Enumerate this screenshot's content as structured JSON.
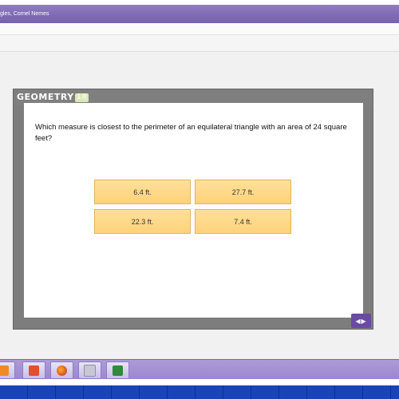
{
  "window": {
    "title": "gles, Cornel Nemes"
  },
  "slide": {
    "logo_text": "GEOMETRY",
    "logo_badge": "18",
    "question": "Which measure is closest to the perimeter of an equilateral triangle with an area of 24 square feet?",
    "answers": [
      "6.4 ft.",
      "27.7 ft.",
      "22.3 ft.",
      "7.4 ft."
    ],
    "nav_label": "◀▶"
  },
  "taskbar": {
    "icons": [
      "office-icon",
      "powerpoint-icon",
      "firefox-icon",
      "media-icon",
      "excel-icon"
    ]
  },
  "colors": {
    "titlebar": "#7f6ab6",
    "answer_fill": "#ffd27a",
    "nav_button": "#6a4aa3",
    "bottom_strip": "#1a43b8"
  }
}
